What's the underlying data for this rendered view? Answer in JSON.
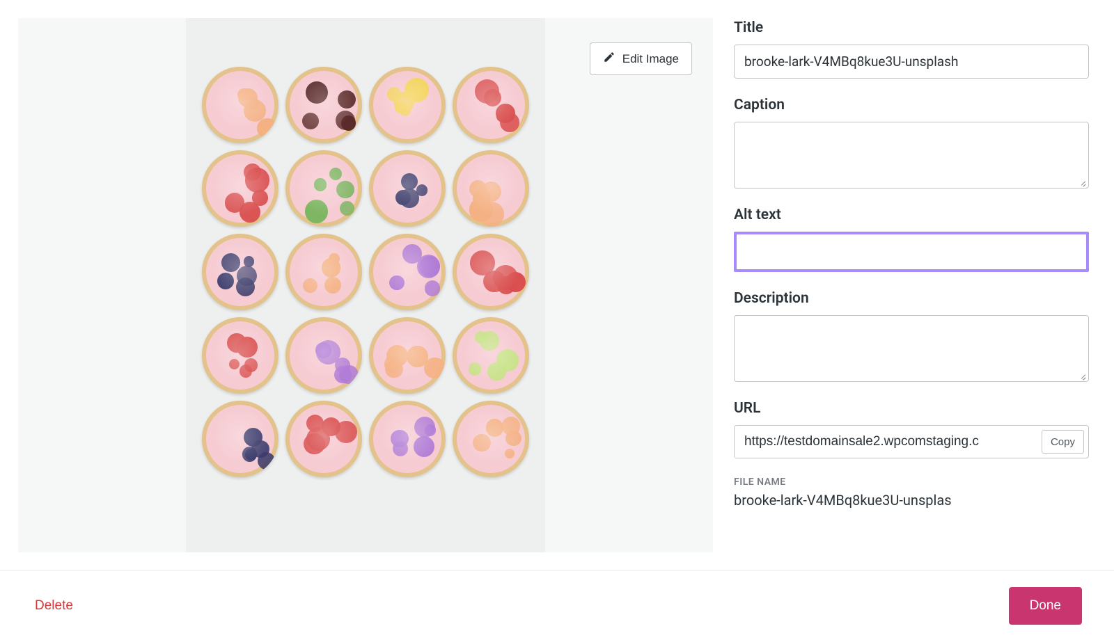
{
  "preview": {
    "edit_label": "Edit Image"
  },
  "fields": {
    "title": {
      "label": "Title",
      "value": "brooke-lark-V4MBq8kue3U-unsplash"
    },
    "caption": {
      "label": "Caption",
      "value": ""
    },
    "alt": {
      "label": "Alt text",
      "value": ""
    },
    "description": {
      "label": "Description",
      "value": ""
    },
    "url": {
      "label": "URL",
      "value": "https://testdomainsale2.wpcomstaging.c",
      "copy_label": "Copy"
    },
    "file_name": {
      "label": "FILE NAME",
      "value": "brooke-lark-V4MBq8kue3U-unsplas"
    }
  },
  "footer": {
    "delete_label": "Delete",
    "done_label": "Done"
  },
  "donut_colors": [
    [
      "#f4b183",
      "#5b2b2b",
      "#f4d35e",
      "#d94e4e"
    ],
    [
      "#d94e4e",
      "#7bb661",
      "#3b3b6b",
      "#f4b183"
    ],
    [
      "#3b3b6b",
      "#f4b183",
      "#b07bd6",
      "#d94e4e"
    ],
    [
      "#d94e4e",
      "#b07bd6",
      "#f4b183",
      "#c5e384"
    ],
    [
      "#3b3b6b",
      "#d94e4e",
      "#b07bd6",
      "#f4b183"
    ]
  ]
}
